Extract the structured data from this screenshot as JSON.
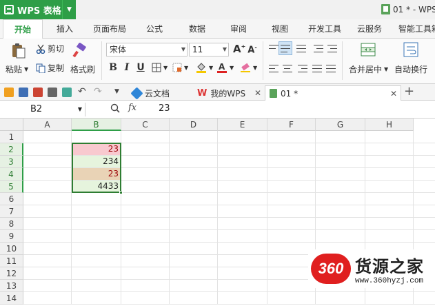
{
  "app": {
    "name": "WPS 表格",
    "doc_title": "01 * - WPS"
  },
  "tabs": [
    "开始",
    "插入",
    "页面布局",
    "公式",
    "数据",
    "审阅",
    "视图",
    "开发工具",
    "云服务",
    "智能工具箱"
  ],
  "ribbon": {
    "paste": "粘贴",
    "cut": "剪切",
    "copy": "复制",
    "format_painter": "格式刷",
    "font": "宋体",
    "font_size": "11",
    "bold": "B",
    "italic": "I",
    "underline": "U",
    "merge_center": "合并居中",
    "wrap_text": "自动换行"
  },
  "doc_tabs": [
    {
      "label": "云文档"
    },
    {
      "label": "我的WPS"
    },
    {
      "label": "01 *"
    }
  ],
  "formula_bar": {
    "cell_ref": "B2",
    "fx": "fx",
    "value": "23"
  },
  "columns": [
    "A",
    "B",
    "C",
    "D",
    "E",
    "F",
    "G",
    "H"
  ],
  "rows": [
    "1",
    "2",
    "3",
    "4",
    "5",
    "6",
    "7",
    "8",
    "9",
    "10",
    "11",
    "12",
    "13",
    "14"
  ],
  "cells": {
    "B2": "23",
    "B3": "234",
    "B4": "23",
    "B5": "4433"
  },
  "cell_fills": {
    "B2": "#f8c9cf",
    "B3": "#e6f4dd",
    "B4": "#e9d3b6",
    "B5": "#e6f4dd"
  },
  "colors": {
    "accent": "#2e9e47",
    "duplicate_text": "#9c0006"
  },
  "watermark": {
    "badge": "360",
    "name": "货源之家",
    "url": "www.360hyzj.com"
  }
}
